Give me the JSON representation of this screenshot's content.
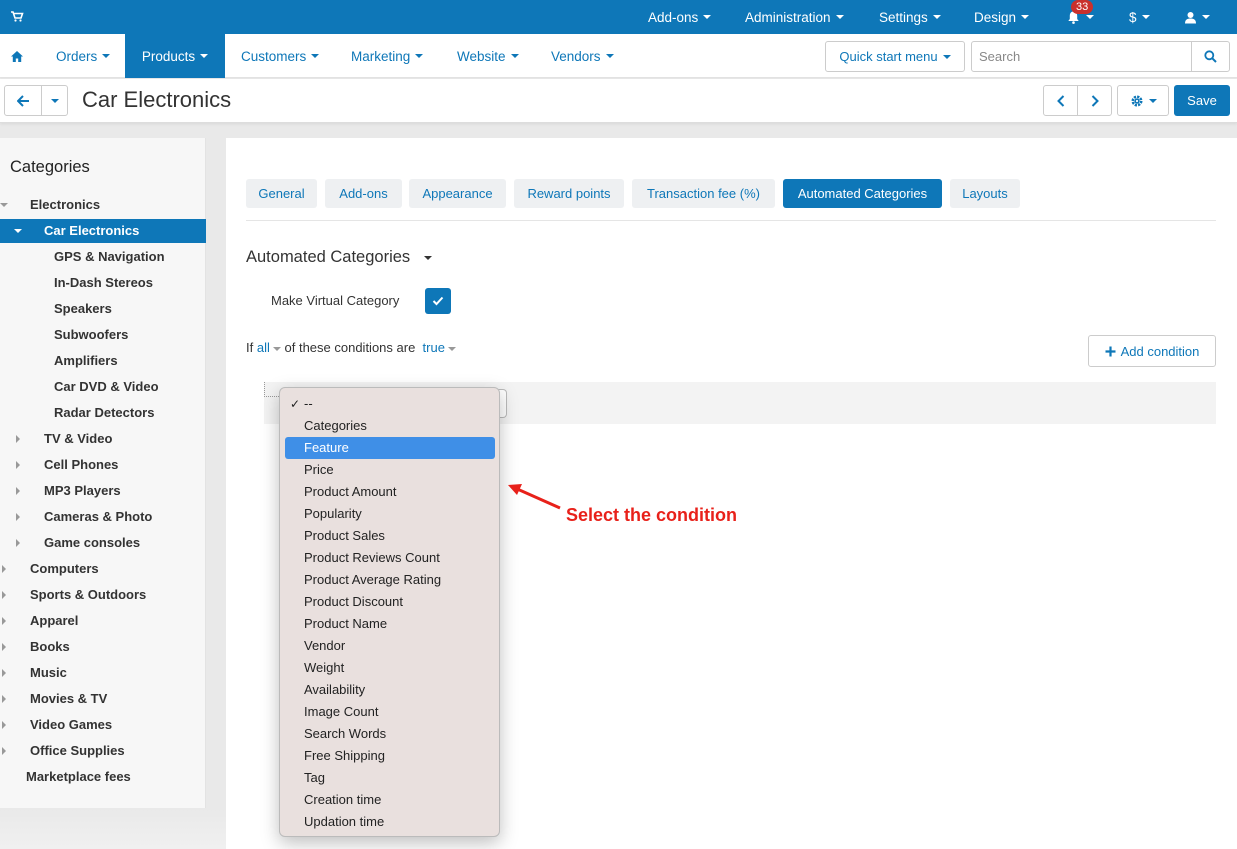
{
  "topbar": {
    "menus": [
      "Add-ons",
      "Administration",
      "Settings",
      "Design"
    ],
    "notifications_count": "33",
    "currency": "$"
  },
  "nav": {
    "items": [
      "Orders",
      "Products",
      "Customers",
      "Marketing",
      "Website",
      "Vendors"
    ],
    "active": "Products",
    "quick_start": "Quick start menu",
    "search_placeholder": "Search"
  },
  "title": {
    "text": "Car Electronics",
    "save_label": "Save"
  },
  "sidebar": {
    "heading": "Categories",
    "items": [
      {
        "label": "Electronics",
        "level": 0,
        "expander": "down"
      },
      {
        "label": "Car Electronics",
        "level": 1,
        "expander": "down",
        "active": true
      },
      {
        "label": "GPS & Navigation",
        "level": 2,
        "expander": "none"
      },
      {
        "label": "In-Dash Stereos",
        "level": 2,
        "expander": "none"
      },
      {
        "label": "Speakers",
        "level": 2,
        "expander": "none"
      },
      {
        "label": "Subwoofers",
        "level": 2,
        "expander": "none"
      },
      {
        "label": "Amplifiers",
        "level": 2,
        "expander": "none"
      },
      {
        "label": "Car DVD & Video",
        "level": 2,
        "expander": "none"
      },
      {
        "label": "Radar Detectors",
        "level": 2,
        "expander": "none"
      },
      {
        "label": "TV & Video",
        "level": 1,
        "expander": "right"
      },
      {
        "label": "Cell Phones",
        "level": 1,
        "expander": "right"
      },
      {
        "label": "MP3 Players",
        "level": 1,
        "expander": "right"
      },
      {
        "label": "Cameras & Photo",
        "level": 1,
        "expander": "right"
      },
      {
        "label": "Game consoles",
        "level": 1,
        "expander": "right"
      },
      {
        "label": "Computers",
        "level": 0,
        "expander": "right"
      },
      {
        "label": "Sports & Outdoors",
        "level": 0,
        "expander": "right"
      },
      {
        "label": "Apparel",
        "level": 0,
        "expander": "right"
      },
      {
        "label": "Books",
        "level": 0,
        "expander": "right"
      },
      {
        "label": "Music",
        "level": 0,
        "expander": "right"
      },
      {
        "label": "Movies & TV",
        "level": 0,
        "expander": "right"
      },
      {
        "label": "Video Games",
        "level": 0,
        "expander": "right"
      },
      {
        "label": "Office Supplies",
        "level": 0,
        "expander": "right"
      },
      {
        "label": "Marketplace fees",
        "level": 0,
        "expander": "none"
      }
    ]
  },
  "tabs": {
    "items": [
      "General",
      "Add-ons",
      "Appearance",
      "Reward points",
      "Transaction fee (%)",
      "Automated Categories",
      "Layouts"
    ],
    "active": "Automated Categories"
  },
  "section": {
    "title": "Automated Categories",
    "virtual_label": "Make Virtual Category",
    "virtual_checked": true,
    "cond_if": "If",
    "cond_all": "all",
    "cond_middle": "of these conditions are",
    "cond_true": "true",
    "add_condition": "Add condition"
  },
  "dropdown": {
    "options": [
      "--",
      "Categories",
      "Feature",
      "Price",
      "Product Amount",
      "Popularity",
      "Product Sales",
      "Product Reviews Count",
      "Product Average Rating",
      "Product Discount",
      "Product Name",
      "Vendor",
      "Weight",
      "Availability",
      "Image Count",
      "Search Words",
      "Free Shipping",
      "Tag",
      "Creation time",
      "Updation time"
    ],
    "checked": "--",
    "highlighted": "Feature"
  },
  "annotation": {
    "text": "Select the condition"
  },
  "colors": {
    "brand": "#0e77b8",
    "highlight": "#3f8fe7",
    "annotation": "#e8211a"
  }
}
